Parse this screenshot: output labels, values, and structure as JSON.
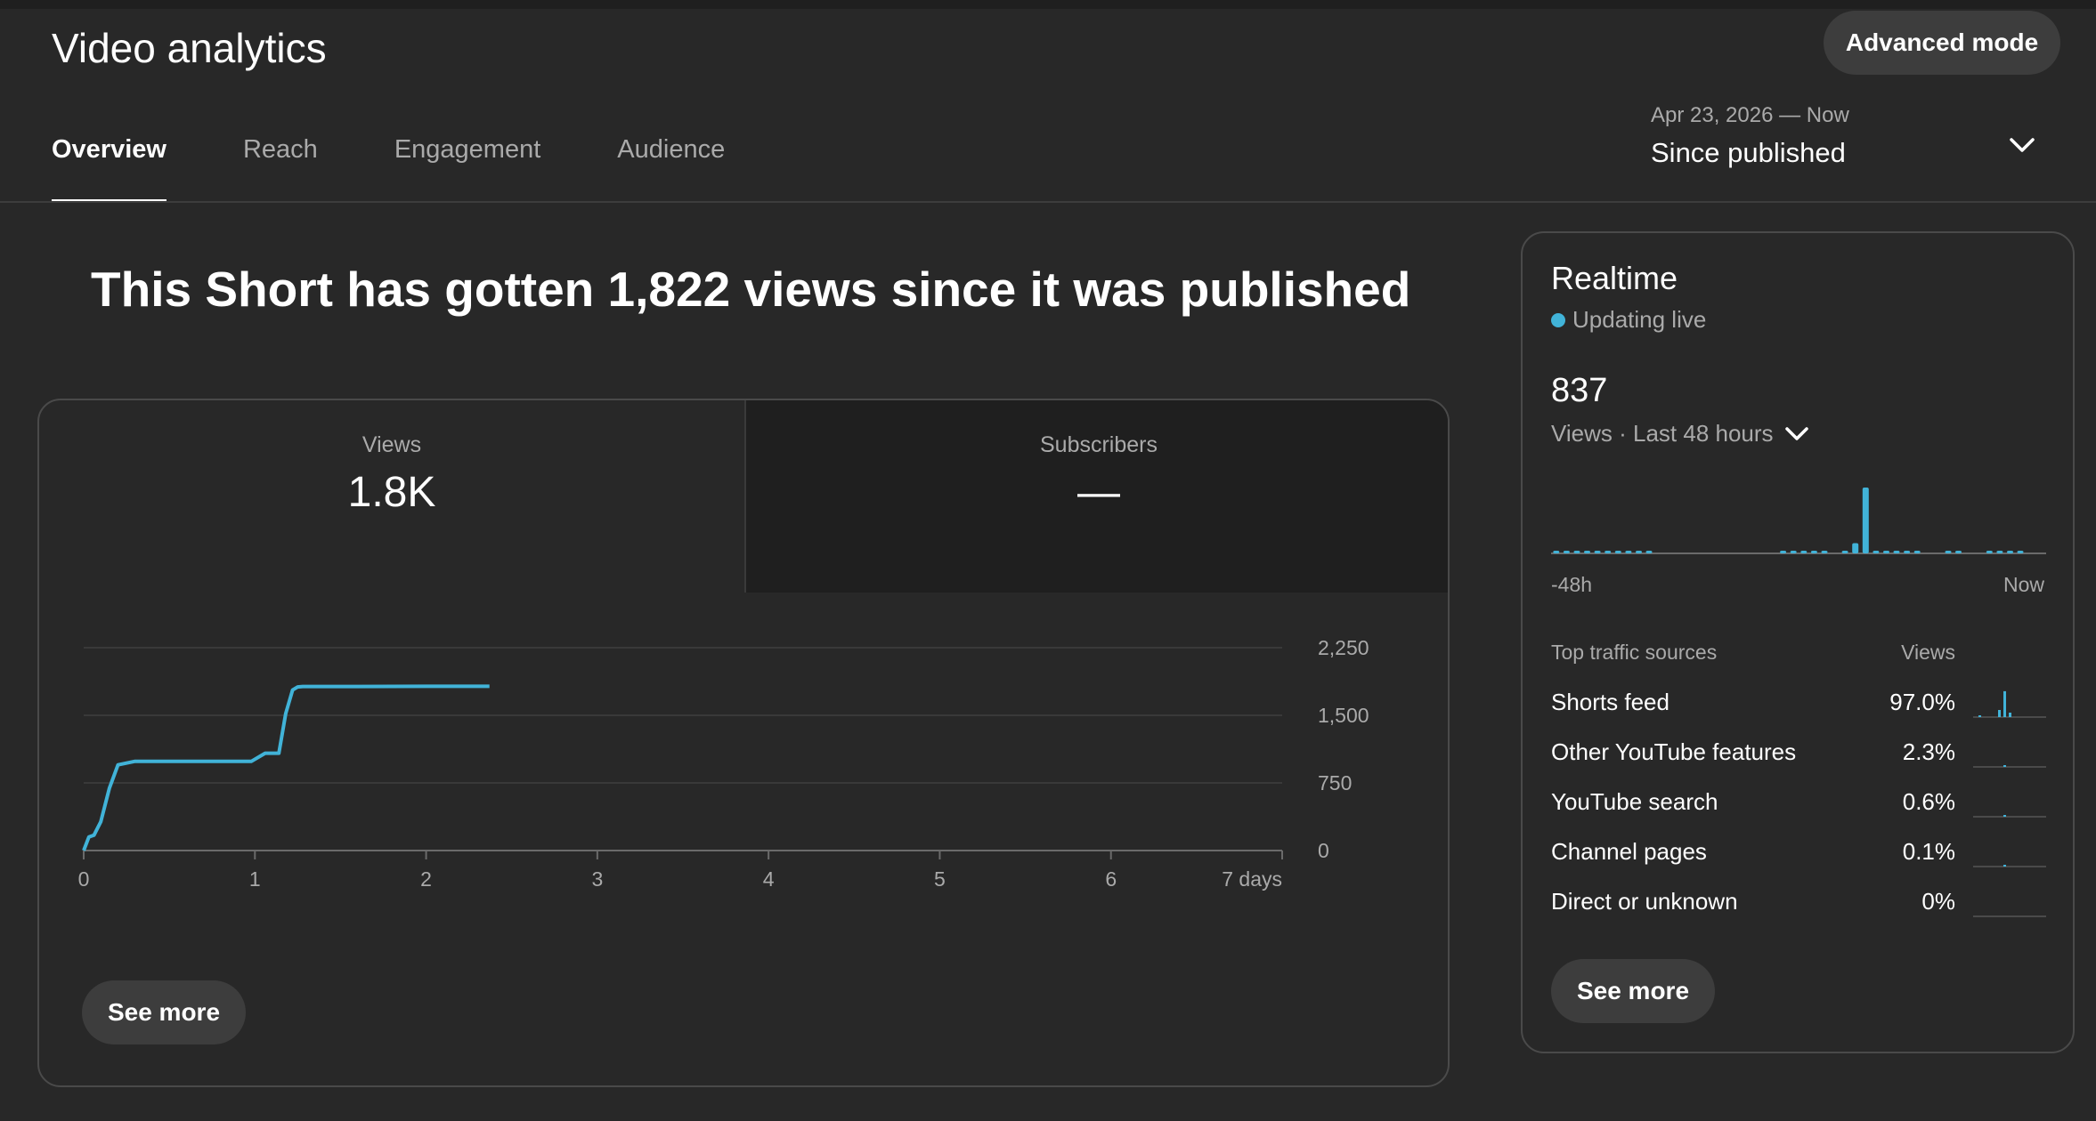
{
  "header": {
    "title": "Video analytics",
    "advanced_mode_label": "Advanced mode"
  },
  "tabs": [
    {
      "label": "Overview",
      "active": true
    },
    {
      "label": "Reach",
      "active": false
    },
    {
      "label": "Engagement",
      "active": false
    },
    {
      "label": "Audience",
      "active": false
    }
  ],
  "date_picker": {
    "range": "Apr 23, 2026 — Now",
    "label": "Since published",
    "icon": "chevron-down-icon"
  },
  "headline": "This Short has gotten 1,822 views since it was published",
  "metrics": {
    "views": {
      "label": "Views",
      "value": "1.8K"
    },
    "subscribers": {
      "label": "Subscribers",
      "value": "—"
    }
  },
  "see_more_label": "See more",
  "colors": {
    "background": "#282828",
    "accent": "#41b3d8",
    "muted_text": "#aaaaaa",
    "button": "#3d3d3d"
  },
  "chart_data": {
    "type": "line",
    "title": "",
    "xlabel": "",
    "ylabel": "",
    "x_ticks": [
      "0",
      "1",
      "2",
      "3",
      "4",
      "5",
      "6",
      "7 days"
    ],
    "y_ticks": [
      "0",
      "750",
      "1,500",
      "2,250"
    ],
    "xlim": [
      0,
      7
    ],
    "ylim": [
      0,
      2250
    ],
    "grid": true,
    "series": [
      {
        "x": [
          0,
          0.03,
          0.06,
          0.1,
          0.15,
          0.2,
          0.3,
          0.5,
          0.8,
          0.98,
          1.06,
          1.14,
          1.18,
          1.22,
          1.25,
          1.28,
          1.4,
          1.6,
          1.8,
          2.0,
          2.2,
          2.37
        ],
        "y": [
          0,
          150,
          170,
          320,
          690,
          950,
          990,
          990,
          990,
          990,
          1080,
          1080,
          1520,
          1780,
          1815,
          1820,
          1820,
          1820,
          1821,
          1822,
          1822,
          1822
        ]
      }
    ]
  },
  "realtime": {
    "title": "Realtime",
    "status": "Updating live",
    "count": "837",
    "period_label": "Views · Last 48 hours",
    "axis_start": "-48h",
    "axis_end": "Now",
    "chart_data": {
      "type": "bar",
      "hours": [
        -48,
        -47,
        -46,
        -45,
        -44,
        -43,
        -42,
        -41,
        -40,
        -39,
        -38,
        -37,
        -36,
        -35,
        -34,
        -33,
        -32,
        -31,
        -30,
        -29,
        -28,
        -27,
        -26,
        -25,
        -24,
        -23,
        -22,
        -21,
        -20,
        -19,
        -18,
        -17,
        -16,
        -15,
        -14,
        -13,
        -12,
        -11,
        -10,
        -9,
        -8,
        -7,
        -6,
        -5,
        -4,
        -3,
        -2,
        -1
      ],
      "values": [
        2,
        2,
        2,
        2,
        2,
        2,
        2,
        2,
        2,
        2,
        0,
        0,
        0,
        0,
        0,
        0,
        0,
        0,
        0,
        0,
        0,
        0,
        2,
        3,
        6,
        4,
        2,
        0,
        2,
        90,
        580,
        15,
        4,
        3,
        2,
        2,
        0,
        0,
        2,
        1,
        0,
        0,
        2,
        2,
        2,
        2,
        0,
        0
      ]
    },
    "traffic_sources": {
      "header_label": "Top traffic sources",
      "header_value": "Views",
      "rows": [
        {
          "name": "Shorts feed",
          "pct": "97.0%",
          "share": 0.97
        },
        {
          "name": "Other YouTube features",
          "pct": "2.3%",
          "share": 0.023
        },
        {
          "name": "YouTube search",
          "pct": "0.6%",
          "share": 0.006
        },
        {
          "name": "Channel pages",
          "pct": "0.1%",
          "share": 0.001
        },
        {
          "name": "Direct or unknown",
          "pct": "0%",
          "share": 0
        }
      ]
    },
    "see_more_label": "See more"
  }
}
